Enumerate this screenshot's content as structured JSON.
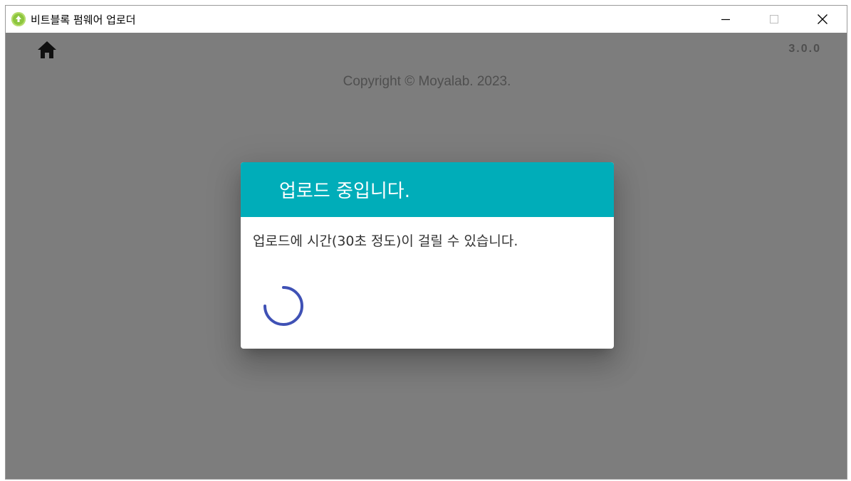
{
  "window": {
    "title": "비트블록 펌웨어 업로더",
    "icon": "upload-app-icon",
    "controls": {
      "minimize_icon": "minimize-icon",
      "maximize_icon": "maximize-icon",
      "close_icon": "close-icon"
    }
  },
  "header": {
    "home_icon": "home-icon",
    "version": "3.0.0"
  },
  "footer": {
    "copyright": "Copyright © Moyalab. 2023."
  },
  "dialog": {
    "title": "업로드 중입니다.",
    "message": "업로드에 시간(30초 정도)이 걸릴 수 있습니다.",
    "spinner_icon": "loading-spinner-icon"
  },
  "colors": {
    "dialog_header": "#00adb9",
    "spinner": "#3f51b5",
    "backdrop": "rgba(0,0,0,0.5)"
  }
}
